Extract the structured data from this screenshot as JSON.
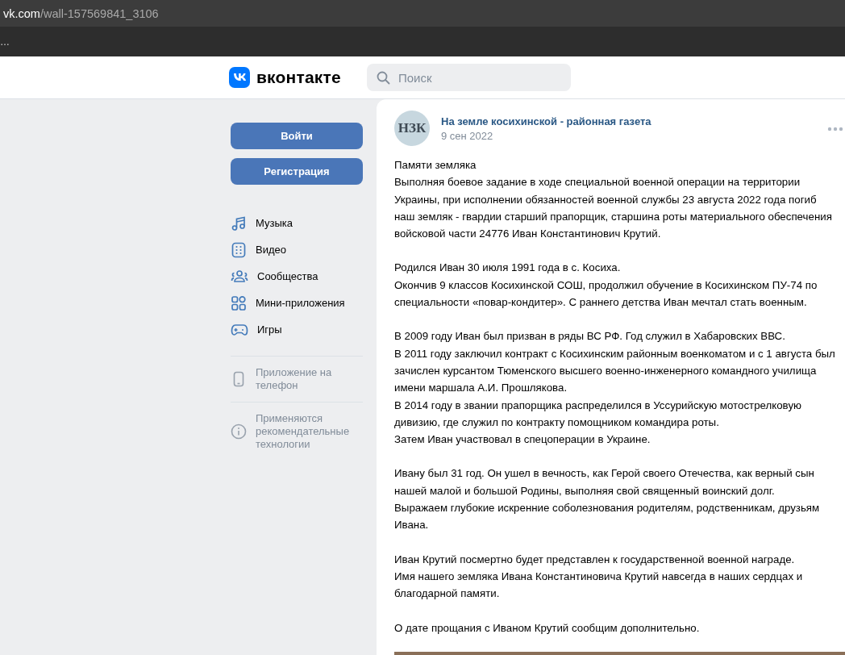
{
  "browser": {
    "url_host": "vk.com",
    "url_path": "/wall-157569841_3106",
    "bar_text": "…"
  },
  "header": {
    "logo_text": "вконтакте",
    "search": {
      "placeholder": "Поиск"
    }
  },
  "sidebar": {
    "buttons": [
      {
        "label": "Войти"
      },
      {
        "label": "Регистрация"
      }
    ],
    "items": [
      {
        "label": "Музыка",
        "kind": "music"
      },
      {
        "label": "Видео",
        "kind": "video"
      },
      {
        "label": "Сообщества",
        "kind": "groups"
      },
      {
        "label": "Мини-приложения",
        "kind": "apps"
      },
      {
        "label": "Игры",
        "kind": "games"
      }
    ],
    "notes": [
      {
        "label": "Приложение на телефон",
        "kind": "phone"
      },
      {
        "label": "Применяются рекомендательные технологии",
        "kind": "info"
      }
    ]
  },
  "post": {
    "avatar_text": "НЗК",
    "author": "На земле косихинской - районная газета",
    "date": "9 сен 2022",
    "paragraphs": [
      [
        "Памяти земляка",
        "Выполняя боевое задание в ходе специальной военной операции на территории Украины, при исполнении обязанностей военной службы 23 августа 2022 года погиб наш земляк - гвардии старший прапорщик, старшина роты материального обеспечения войсковой части 24776 Иван Константинович Крутий."
      ],
      [
        "Родился Иван 30 июля 1991 года в с. Косиха.",
        "Окончив 9 классов Косихинской СОШ, продолжил обучение в Косихинском ПУ-74 по специальности «повар-кондитер». С раннего детства Иван мечтал стать военным."
      ],
      [
        "В 2009 году Иван был призван в ряды ВС РФ. Год служил в  Хабаровских ВВС.",
        "В 2011 году заключил контракт с Косихинским районным военкоматом и с 1 августа был зачислен курсантом Тюменского высшего военно-инженерного командного училища имени маршала А.И. Прошлякова.",
        "В 2014 году в звании прапорщика распределился в Уссурийскую мотострелковую дивизию, где служил по контракту помощником командира роты.",
        "Затем Иван участвовал в спецоперации в Украине."
      ],
      [
        "Ивану был 31 год. Он ушел в вечность, как Герой своего Отечества, как верный сын нашей малой и большой Родины, выполняя свой священный воинский долг.",
        "Выражаем глубокие искренние соболезнования родителям, родственникам, друзьям Ивана."
      ],
      [
        "Иван Крутий посмертно будет представлен к государственной военной награде.",
        "Имя нашего земляка Ивана Константиновича Крутий навсегда в наших сердцах и благодарной памяти."
      ],
      [
        "О дате прощания с Иваном Крутий сообщим дополнительно."
      ]
    ]
  }
}
